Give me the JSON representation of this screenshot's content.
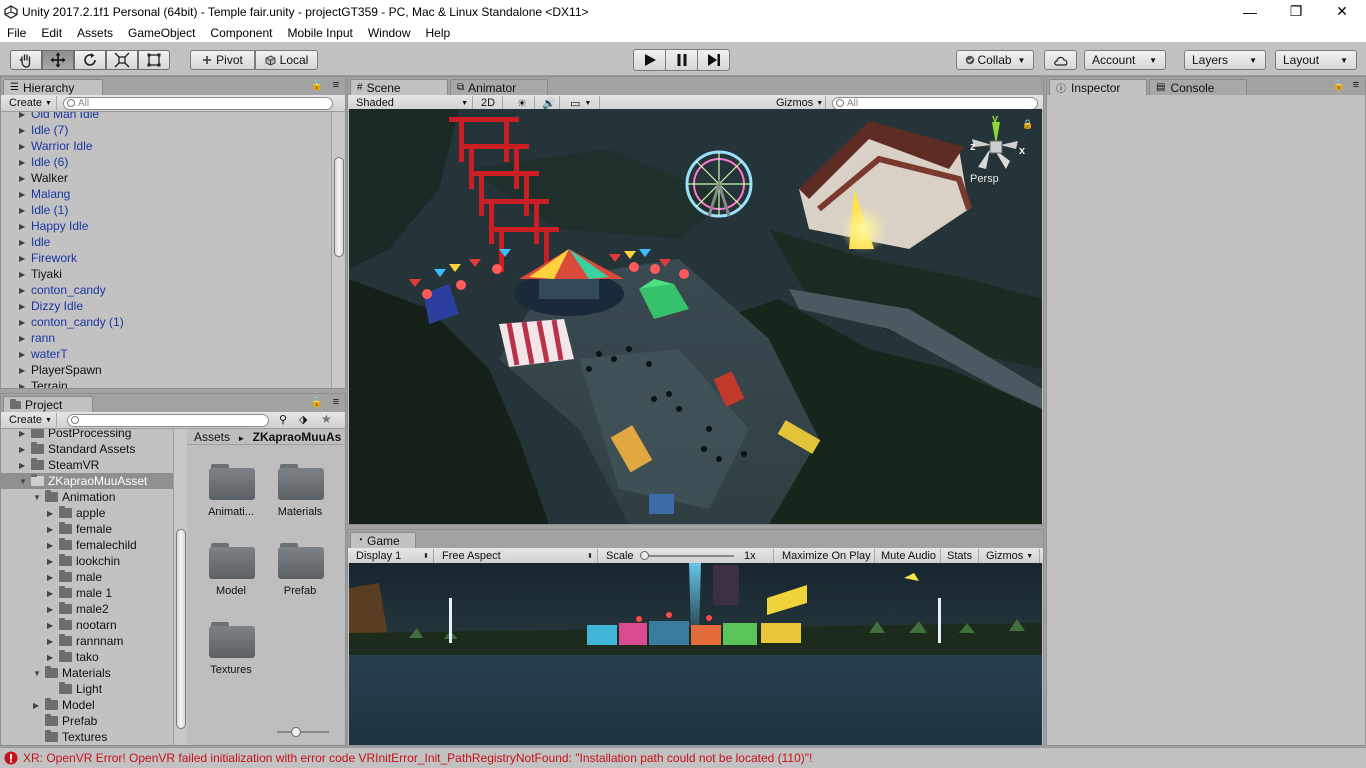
{
  "window": {
    "title": "Unity 2017.2.1f1 Personal (64bit) - Temple fair.unity - projectGT359 - PC, Mac & Linux Standalone <DX11>",
    "minimize": "—",
    "maximize": "❐",
    "close": "✕"
  },
  "menu": [
    "File",
    "Edit",
    "Assets",
    "GameObject",
    "Component",
    "Mobile Input",
    "Window",
    "Help"
  ],
  "toolbar": {
    "pivot": "Pivot",
    "local": "Local",
    "collab": "Collab",
    "account": "Account",
    "layers": "Layers",
    "layout": "Layout"
  },
  "hierarchy": {
    "tab": "Hierarchy",
    "create": "Create",
    "search_placeholder": "All",
    "items": [
      {
        "label": "Old Man Idle",
        "prefab": true
      },
      {
        "label": "Idle (7)",
        "prefab": true
      },
      {
        "label": "Warrior Idle",
        "prefab": true
      },
      {
        "label": "Idle (6)",
        "prefab": true
      },
      {
        "label": "Walker",
        "prefab": false
      },
      {
        "label": "Malang",
        "prefab": true
      },
      {
        "label": "Idle (1)",
        "prefab": true
      },
      {
        "label": "Happy Idle",
        "prefab": true
      },
      {
        "label": "Idle",
        "prefab": true
      },
      {
        "label": "Firework",
        "prefab": true
      },
      {
        "label": "Tiyaki",
        "prefab": false
      },
      {
        "label": "conton_candy",
        "prefab": true
      },
      {
        "label": "Dizzy Idle",
        "prefab": true
      },
      {
        "label": "conton_candy (1)",
        "prefab": true
      },
      {
        "label": "rann",
        "prefab": true
      },
      {
        "label": "waterT",
        "prefab": true
      },
      {
        "label": "PlayerSpawn",
        "prefab": false
      },
      {
        "label": "Terrain",
        "prefab": false
      }
    ]
  },
  "project": {
    "tab": "Project",
    "create": "Create",
    "tree": [
      {
        "label": "PostProcessing",
        "depth": 1,
        "arrow": "▶"
      },
      {
        "label": "Standard Assets",
        "depth": 1,
        "arrow": "▶"
      },
      {
        "label": "SteamVR",
        "depth": 1,
        "arrow": "▶"
      },
      {
        "label": "ZKapraoMuuAsset",
        "depth": 1,
        "arrow": "▼",
        "selected": true
      },
      {
        "label": "Animation",
        "depth": 2,
        "arrow": "▼"
      },
      {
        "label": "apple",
        "depth": 3,
        "arrow": "▶"
      },
      {
        "label": "female",
        "depth": 3,
        "arrow": "▶"
      },
      {
        "label": "femalechild",
        "depth": 3,
        "arrow": "▶"
      },
      {
        "label": "lookchin",
        "depth": 3,
        "arrow": "▶"
      },
      {
        "label": "male",
        "depth": 3,
        "arrow": "▶"
      },
      {
        "label": "male 1",
        "depth": 3,
        "arrow": "▶"
      },
      {
        "label": "male2",
        "depth": 3,
        "arrow": "▶"
      },
      {
        "label": "nootarn",
        "depth": 3,
        "arrow": "▶"
      },
      {
        "label": "rannnam",
        "depth": 3,
        "arrow": "▶"
      },
      {
        "label": "tako",
        "depth": 3,
        "arrow": "▶"
      },
      {
        "label": "Materials",
        "depth": 2,
        "arrow": "▼"
      },
      {
        "label": "Light",
        "depth": 3,
        "arrow": ""
      },
      {
        "label": "Model",
        "depth": 2,
        "arrow": "▶"
      },
      {
        "label": "Prefab",
        "depth": 2,
        "arrow": ""
      },
      {
        "label": "Textures",
        "depth": 2,
        "arrow": ""
      }
    ],
    "breadcrumb_root": "Assets",
    "breadcrumb_sep": "►",
    "breadcrumb_current": "ZKapraoMuuAs",
    "folders": [
      "Animati...",
      "Materials",
      "Model",
      "Prefab",
      "Textures"
    ]
  },
  "scene": {
    "tab": "Scene",
    "animator_tab": "Animator",
    "shading": "Shaded",
    "mode_2d": "2D",
    "gizmos": "Gizmos",
    "search_placeholder": "All",
    "persp": "Persp",
    "axis_x": "x",
    "axis_y": "y",
    "axis_z": "z"
  },
  "game": {
    "tab": "Game",
    "display": "Display 1",
    "aspect": "Free Aspect",
    "scale_label": "Scale",
    "scale_value": "1x",
    "maximize": "Maximize On Play",
    "mute": "Mute Audio",
    "stats": "Stats",
    "gizmos": "Gizmos"
  },
  "inspector": {
    "tab": "Inspector",
    "console_tab": "Console"
  },
  "status": {
    "message": "XR: OpenVR Error! OpenVR failed initialization with error code VRInitError_Init_PathRegistryNotFound: \"Installation path could not be located (110)\"!"
  },
  "colors": {
    "error_red": "#c8101a",
    "prefab_blue": "#1b36a0",
    "panel_bg": "#c2c2c2"
  }
}
